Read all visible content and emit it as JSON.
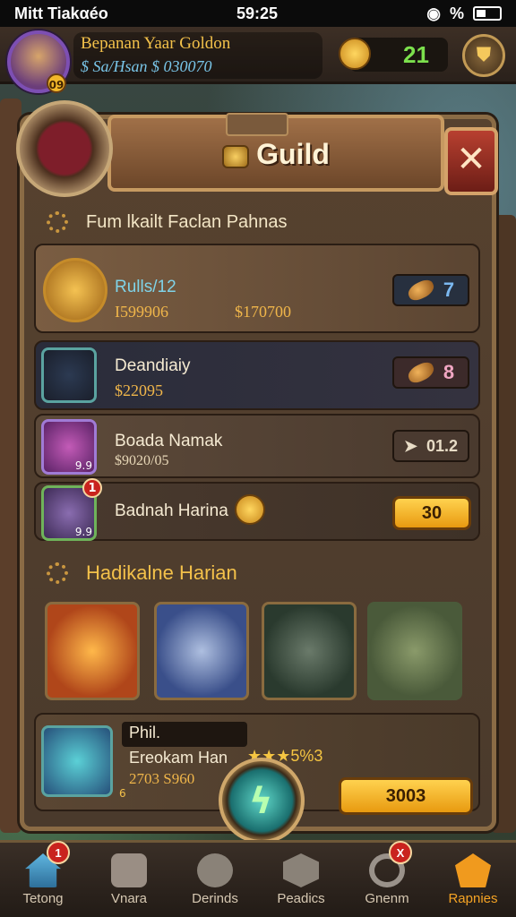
{
  "status_bar": {
    "carrier": "Mitt Tiakαéo",
    "time": "59:25",
    "battery_text": "%"
  },
  "hud": {
    "player_level": "09",
    "player_name": "Bepanan Yaar Goldon",
    "player_gold": "$ Sa/Hsan $ 030070",
    "gems": "21"
  },
  "panel": {
    "title": "Guild"
  },
  "section1": {
    "header": "Fum lkailt Faclan Pahnas"
  },
  "rows": [
    {
      "name": "Rulls/12",
      "value1": "I599906",
      "value2": "$170700",
      "pill_value": "7",
      "name_color": "#7fd3e8"
    },
    {
      "name": "Deandiaiy",
      "value": "$22095",
      "pill_value": "8"
    },
    {
      "name": "Boada Namak",
      "value": "$9020/05",
      "pill_value": "01.2",
      "icon_value": "9.9"
    },
    {
      "name": "Badnah Harina",
      "pill_value": "30",
      "badge": "1",
      "icon_value": "9.9"
    }
  ],
  "section2": {
    "header": "Hadikalne Harian"
  },
  "bottom_card": {
    "name": "Phil.",
    "subtitle": "Ereokam Han",
    "stars": "★★★5%3",
    "value": "2703 S960",
    "icon_value": "6",
    "button": "3003"
  },
  "nav": [
    {
      "label": "Tetong",
      "badge": "1"
    },
    {
      "label": "Vnara"
    },
    {
      "label": "Derinds"
    },
    {
      "label": "Peadics"
    },
    {
      "label": "Gnenm",
      "badge": "X"
    },
    {
      "label": "Rapnies",
      "active": true
    }
  ]
}
